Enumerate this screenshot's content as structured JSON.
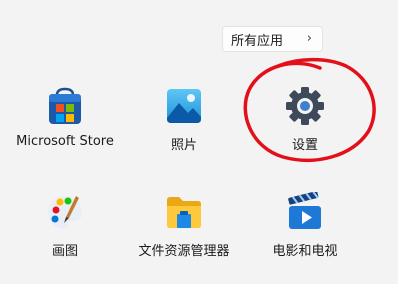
{
  "all_apps": {
    "label": "所有应用",
    "chevron": "›",
    "icon": "chevron-right-icon"
  },
  "apps": [
    {
      "label": "Microsoft Store",
      "icon": "microsoft-store-icon"
    },
    {
      "label": "照片",
      "icon": "photos-icon"
    },
    {
      "label": "设置",
      "icon": "settings-gear-icon"
    },
    {
      "label": "画图",
      "icon": "paint-icon"
    },
    {
      "label": "文件资源管理器",
      "icon": "file-explorer-icon"
    },
    {
      "label": "电影和电视",
      "icon": "movies-tv-icon"
    }
  ],
  "annotation": {
    "color": "#e3101a",
    "icon": "red-circle-annotation"
  },
  "colors": {
    "background": "#f3f3f3",
    "gear": "#3e4a5a"
  }
}
